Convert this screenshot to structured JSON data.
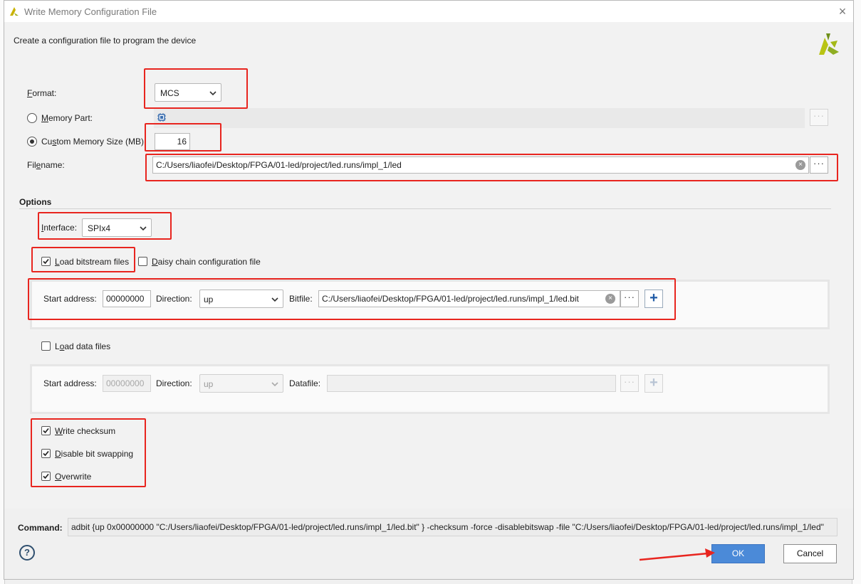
{
  "window": {
    "title": "Write Memory Configuration File",
    "subtitle": "Create a configuration file to program the device"
  },
  "form": {
    "format_label": "Format:",
    "format_value": "MCS",
    "memory_part_label": "Memory Part:",
    "memory_part_selected": false,
    "custom_size_label": "Custom Memory Size (MB):",
    "custom_size_selected": true,
    "custom_size_value": "16",
    "filename_label": "Filename:",
    "filename_value": "C:/Users/liaofei/Desktop/FPGA/01-led/project/led.runs/impl_1/led"
  },
  "options": {
    "heading": "Options",
    "interface_label": "Interface:",
    "interface_value": "SPIx4",
    "load_bitstream_label": "Load bitstream files",
    "load_bitstream_checked": true,
    "daisy_chain_label": "Daisy chain configuration file",
    "daisy_chain_checked": false,
    "bitstream": {
      "start_label": "Start address:",
      "start_value": "00000000",
      "direction_label": "Direction:",
      "direction_value": "up",
      "file_label": "Bitfile:",
      "file_value": "C:/Users/liaofei/Desktop/FPGA/01-led/project/led.runs/impl_1/led.bit"
    },
    "load_data_label": "Load data files",
    "load_data_checked": false,
    "datafile": {
      "start_label": "Start address:",
      "start_value": "00000000",
      "direction_label": "Direction:",
      "direction_value": "up",
      "file_label": "Datafile:",
      "file_value": ""
    },
    "write_checksum_label": "Write checksum",
    "write_checksum_checked": true,
    "disable_swap_label": "Disable bit swapping",
    "disable_swap_checked": true,
    "overwrite_label": "Overwrite",
    "overwrite_checked": true
  },
  "footer": {
    "command_label": "Command:",
    "command_value": "adbit {up 0x00000000 \"C:/Users/liaofei/Desktop/FPGA/01-led/project/led.runs/impl_1/led.bit\" } -checksum -force -disablebitswap -file \"C:/Users/liaofei/Desktop/FPGA/01-led/project/led.runs/impl_1/led\"",
    "help_label": "?",
    "ok_label": "OK",
    "cancel_label": "Cancel"
  },
  "colors": {
    "annotation_red": "#e8251f",
    "ok_blue": "#4b8ad8"
  },
  "icons": [
    "xilinx-logo-icon",
    "chip-icon",
    "chevron-down-icon",
    "clear-icon",
    "browse-icon",
    "add-icon",
    "help-icon",
    "close-icon",
    "check-icon"
  ]
}
